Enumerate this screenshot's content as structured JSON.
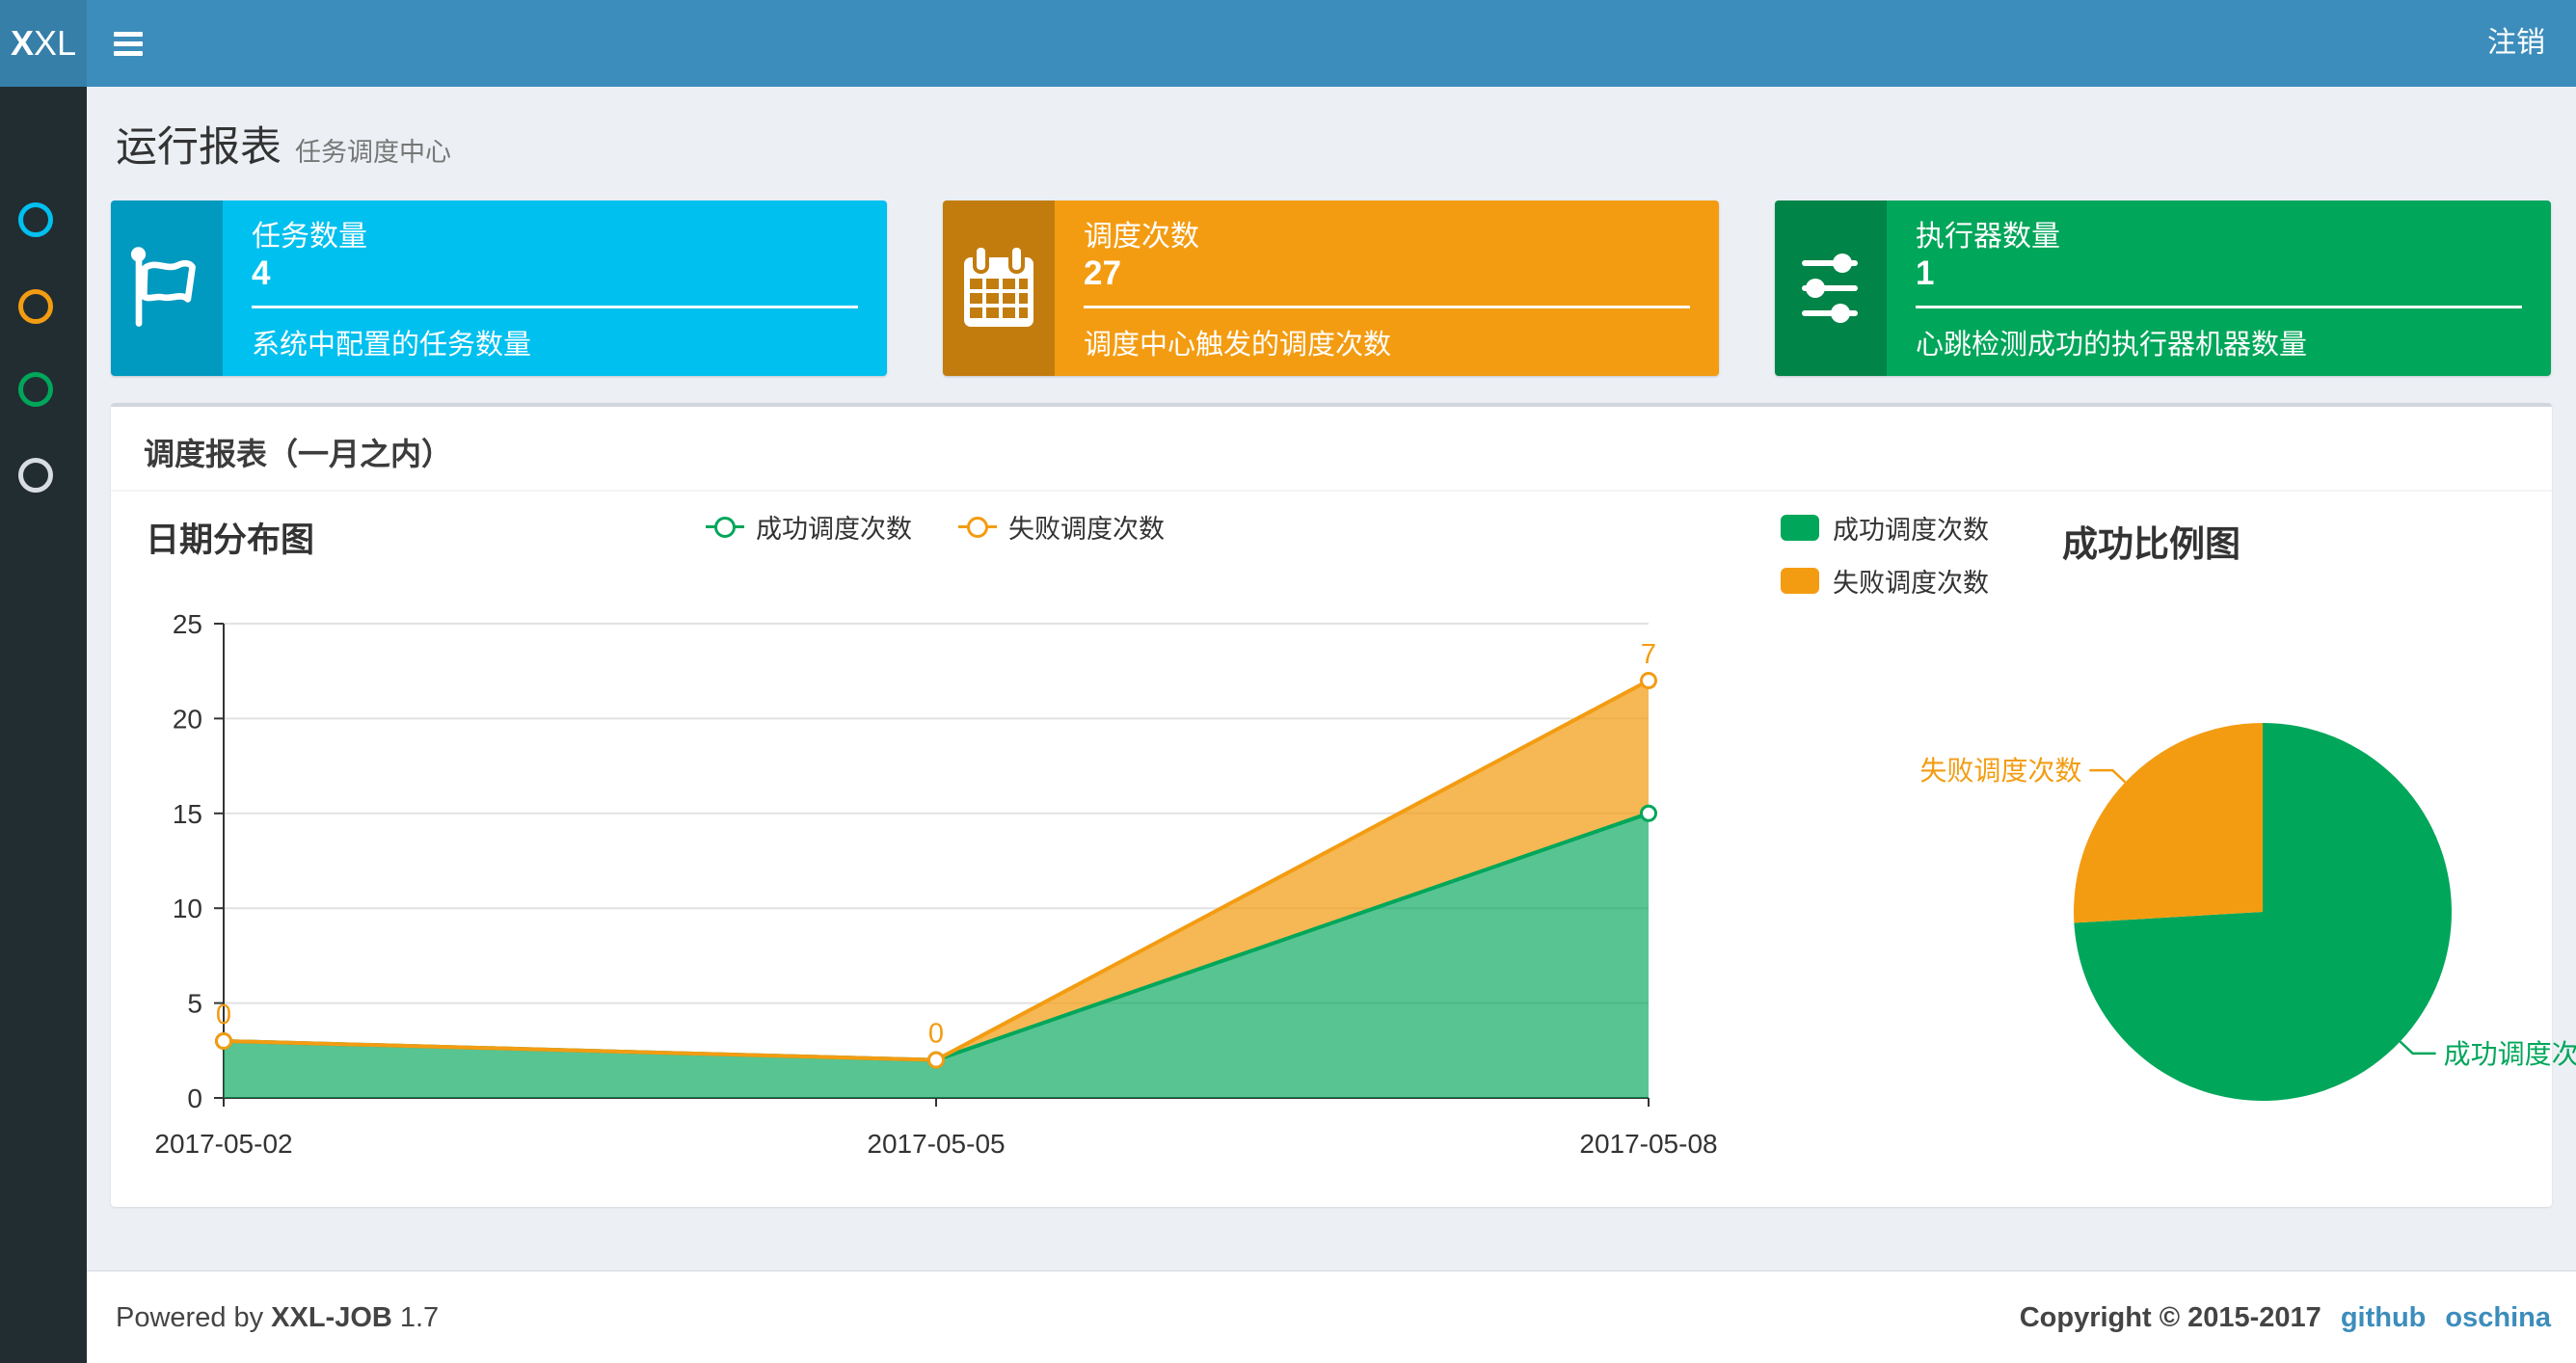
{
  "navbar": {
    "logo_bold": "X",
    "logo_rest": "XL",
    "logout_label": "注销"
  },
  "sidebar": {
    "items": [
      {
        "name": "menu-item-1",
        "color": "#00c0ef"
      },
      {
        "name": "menu-item-2",
        "color": "#f39c12"
      },
      {
        "name": "menu-item-3",
        "color": "#00a65a"
      },
      {
        "name": "menu-item-4",
        "color": "#d8dce3"
      }
    ]
  },
  "page_header": {
    "title": "运行报表",
    "subtitle": "任务调度中心"
  },
  "info_boxes": [
    {
      "label": "任务数量",
      "value": "4",
      "desc": "系统中配置的任务数量",
      "color": "#00c0ef",
      "icon": "flag-icon"
    },
    {
      "label": "调度次数",
      "value": "27",
      "desc": "调度中心触发的调度次数",
      "color": "#f39c12",
      "icon": "calendar-icon"
    },
    {
      "label": "执行器数量",
      "value": "1",
      "desc": "心跳检测成功的执行器机器数量",
      "color": "#00a65a",
      "icon": "sliders-icon"
    }
  ],
  "panel": {
    "title": "调度报表（一月之内）"
  },
  "chart_data": [
    {
      "type": "area",
      "title": "日期分布图",
      "stacked": true,
      "x": [
        "2017-05-02",
        "2017-05-05",
        "2017-05-08"
      ],
      "series": [
        {
          "name": "成功调度次数",
          "color": "#00a65a",
          "values": [
            3,
            2,
            15
          ]
        },
        {
          "name": "失败调度次数",
          "color": "#f39c12",
          "values": [
            0,
            0,
            7
          ],
          "stacked_totals": [
            3,
            2,
            22
          ],
          "point_labels": [
            "0",
            "0",
            "7"
          ]
        }
      ],
      "ylim": [
        0,
        25
      ],
      "yticks": [
        0,
        5,
        10,
        15,
        20,
        25
      ],
      "legend_position": "top-center",
      "grid": true
    },
    {
      "type": "pie",
      "title": "成功比例图",
      "slices": [
        {
          "name": "成功调度次数",
          "value": 20,
          "color": "#00a65a"
        },
        {
          "name": "失败调度次数",
          "value": 7,
          "color": "#f39c12"
        }
      ],
      "legend_position": "top-left"
    }
  ],
  "footer": {
    "powered_prefix": "Powered by",
    "product": "XXL-JOB",
    "version": "1.7",
    "copyright": "Copyright © 2015-2017",
    "links": [
      {
        "label": "github"
      },
      {
        "label": "oschina"
      }
    ],
    "link_color": "#3c8dbc"
  }
}
